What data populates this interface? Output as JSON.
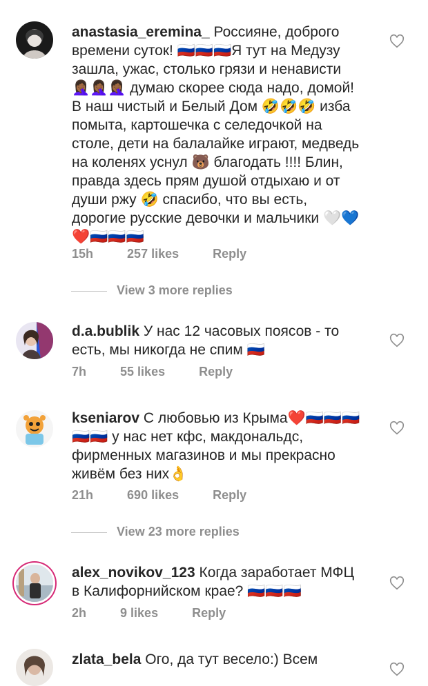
{
  "comments": [
    {
      "username": "anastasia_eremina_",
      "text": "Россияне, доброго времени суток! 🇷🇺🇷🇺🇷🇺Я тут на Медузу зашла, ужас, столько грязи и ненависти 🤦🏾‍♀️🤦🏾‍♀️🤦🏾‍♀️ думаю скорее сюда надо, домой! В наш чистый и Белый Дом 🤣🤣🤣 изба помыта, картошечка с селедочкой на столе, дети на балалайке играют, медведь на коленях уснул 🐻 благодать !!!! Блин, правда здесь прям душой отдыхаю и от души ржу 🤣 спасибо, что вы есть, дорогие русские девочки и мальчики 🤍💙❤️🇷🇺🇷🇺🇷🇺",
      "time": "15h",
      "likes": "257 likes",
      "reply": "Reply",
      "more_replies": "View 3 more replies"
    },
    {
      "username": "d.a.bublik",
      "text": "У нас 12 часовых поясов - то есть, мы никогда не спим 🇷🇺",
      "time": "7h",
      "likes": "55 likes",
      "reply": "Reply"
    },
    {
      "username": "kseniarov",
      "text": "С любовью из Крыма❤️🇷🇺🇷🇺🇷🇺🇷🇺🇷🇺 у нас нет кфс, макдональдс, фирменных магазинов и мы прекрасно живём без них👌",
      "time": "21h",
      "likes": "690 likes",
      "reply": "Reply",
      "more_replies": "View 23 more replies"
    },
    {
      "username": "alex_novikov_123",
      "text": "Когда заработает МФЦ в Калифорнийском крае? 🇷🇺🇷🇺🇷🇺",
      "time": "2h",
      "likes": "9 likes",
      "reply": "Reply"
    },
    {
      "username": "zlata_bela",
      "text": "Ого, да тут весело:) Всем"
    }
  ],
  "icons": {
    "like": "heart-outline-icon",
    "avatar": "user-avatar"
  },
  "colors": {
    "text": "#262626",
    "meta": "#8e8e8e",
    "story_ring": "#d62976"
  }
}
